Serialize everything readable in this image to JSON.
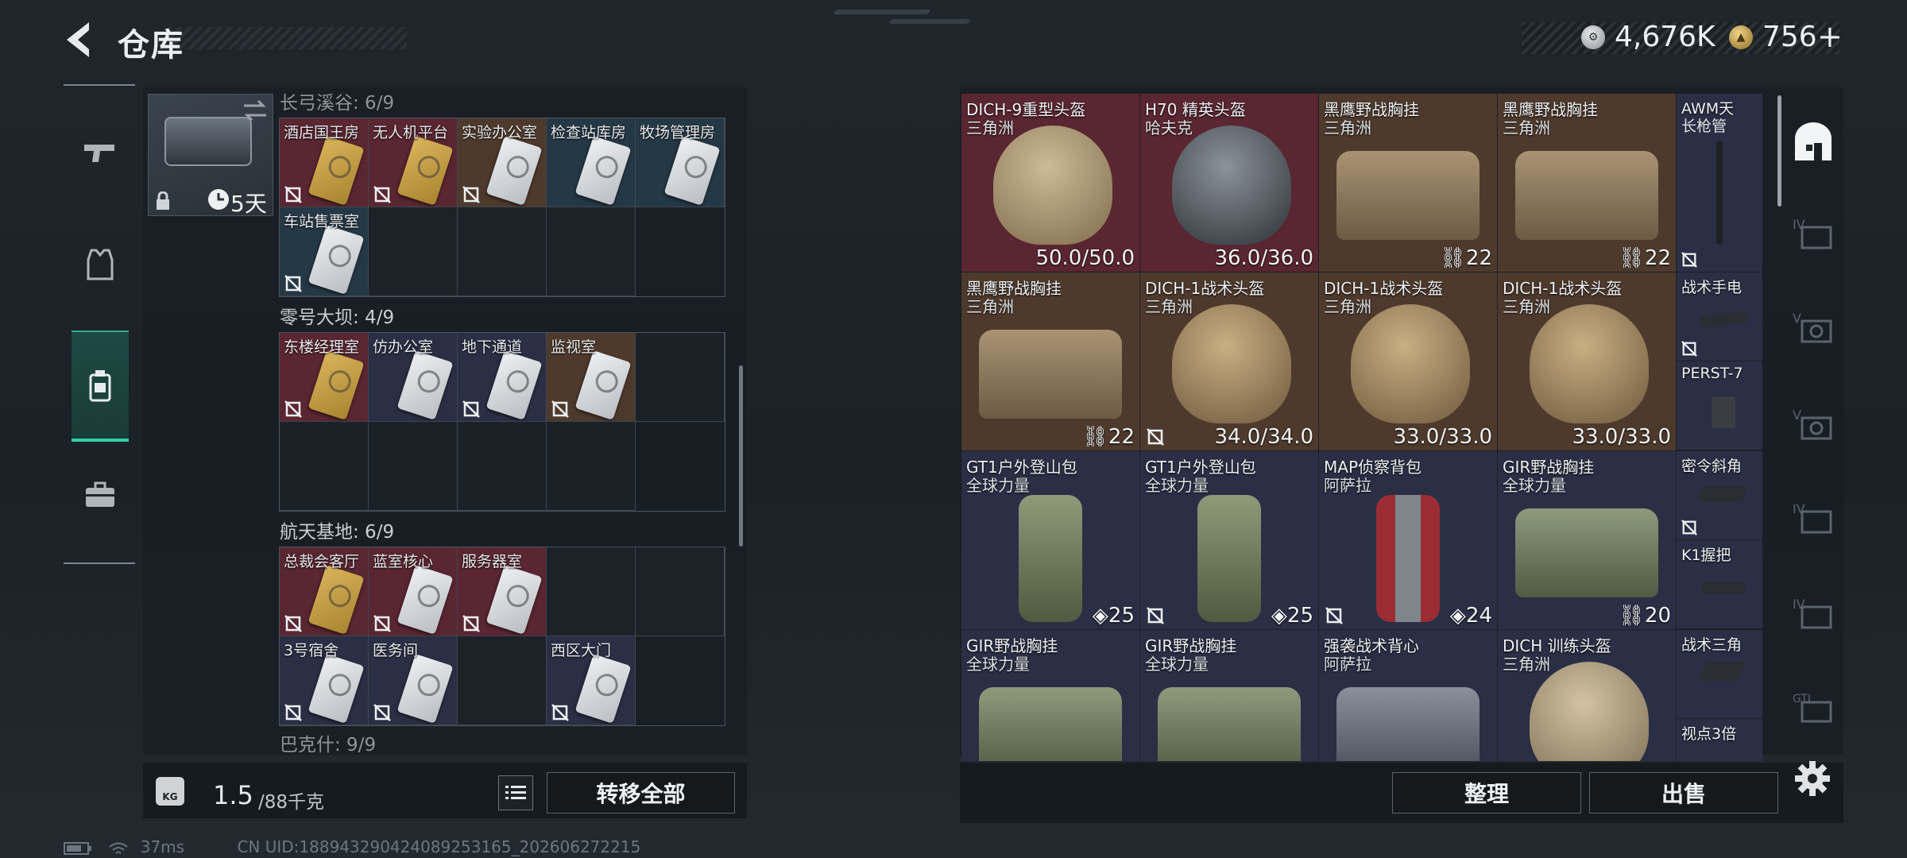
{
  "header": {
    "title": "仓库"
  },
  "currency": [
    {
      "icon": "silver-coin-icon",
      "value": "4,676K"
    },
    {
      "icon": "gold-coin-icon",
      "value": "756"
    }
  ],
  "currency_add": "+",
  "bag": {
    "days": "5天"
  },
  "sections": [
    {
      "title": "长弓溪谷: 6/9"
    },
    {
      "title": "零号大坝: 4/9"
    },
    {
      "title": "航天基地: 6/9"
    },
    {
      "title": "巴克什: 9/9"
    }
  ],
  "keys": {
    "g1": [
      "酒店国王房",
      "无人机平台",
      "实验办公室",
      "检查站库房",
      "牧场管理房",
      "车站售票室"
    ],
    "g2": [
      "东楼经理室",
      "仿办公室",
      "地下通道",
      "监视室"
    ],
    "g3": [
      "总裁会客厅",
      "蓝室核心",
      "服务器室",
      "3号宿舍",
      "医务间",
      "西区大门"
    ]
  },
  "weight": {
    "current": "1.5",
    "max": "/88千克",
    "icon_label": "KG"
  },
  "buttons": {
    "transfer_all": "转移全部",
    "sort": "整理",
    "sell": "出售"
  },
  "status": {
    "ping": "37ms",
    "uid": "CN UID:18894329042408925316​5_202606272215"
  },
  "items": [
    {
      "n1": "DICH-9重型头盔",
      "n2": "三角洲",
      "value": "50.0/50.0"
    },
    {
      "n1": "H70 精英头盔",
      "n2": "哈夫克",
      "value": "36.0/36.0"
    },
    {
      "n1": "黑鹰野战胸挂",
      "n2": "三角洲",
      "value": "22"
    },
    {
      "n1": "黑鹰野战胸挂",
      "n2": "三角洲",
      "value": "22"
    },
    {
      "n1": "黑鹰野战胸挂",
      "n2": "三角洲",
      "value": "22"
    },
    {
      "n1": "DICH-1战术头盔",
      "n2": "三角洲",
      "value": "34.0/34.0"
    },
    {
      "n1": "DICH-1战术头盔",
      "n2": "三角洲",
      "value": "33.0/33.0"
    },
    {
      "n1": "DICH-1战术头盔",
      "n2": "三角洲",
      "value": "33.0/33.0"
    },
    {
      "n1": "GT1户外登山包",
      "n2": "全球力量",
      "value": "25"
    },
    {
      "n1": "GT1户外登山包",
      "n2": "全球力量",
      "value": "25"
    },
    {
      "n1": "MAP侦察背包",
      "n2": "阿萨拉",
      "value": "24"
    },
    {
      "n1": "GIR野战胸挂",
      "n2": "全球力量",
      "value": "20"
    },
    {
      "n1": "GIR野战胸挂",
      "n2": "全球力量",
      "value": ""
    },
    {
      "n1": "GIR野战胸挂",
      "n2": "全球力量",
      "value": ""
    },
    {
      "n1": "强袭战术背心",
      "n2": "阿萨拉",
      "value": ""
    },
    {
      "n1": "DICH 训练头盔",
      "n2": "三角洲",
      "value": ""
    }
  ],
  "small_items": [
    {
      "n1": "AWM天",
      "n2": "长枪管"
    },
    {
      "n1": "战术手电",
      "n2": ""
    },
    {
      "n1": "PERST-7",
      "n2": ""
    },
    {
      "n1": "密令斜角",
      "n2": ""
    },
    {
      "n1": "K1握把",
      "n2": ""
    },
    {
      "n1": "战术三角",
      "n2": ""
    },
    {
      "n1": "视点3倍",
      "n2": ""
    }
  ],
  "colors": {
    "accent": "#33d1a8",
    "red_rarity": "#5a2631",
    "brown_rarity": "#4e3a2d",
    "navy_rarity": "#2b2f45",
    "blue_rarity": "#253846"
  }
}
